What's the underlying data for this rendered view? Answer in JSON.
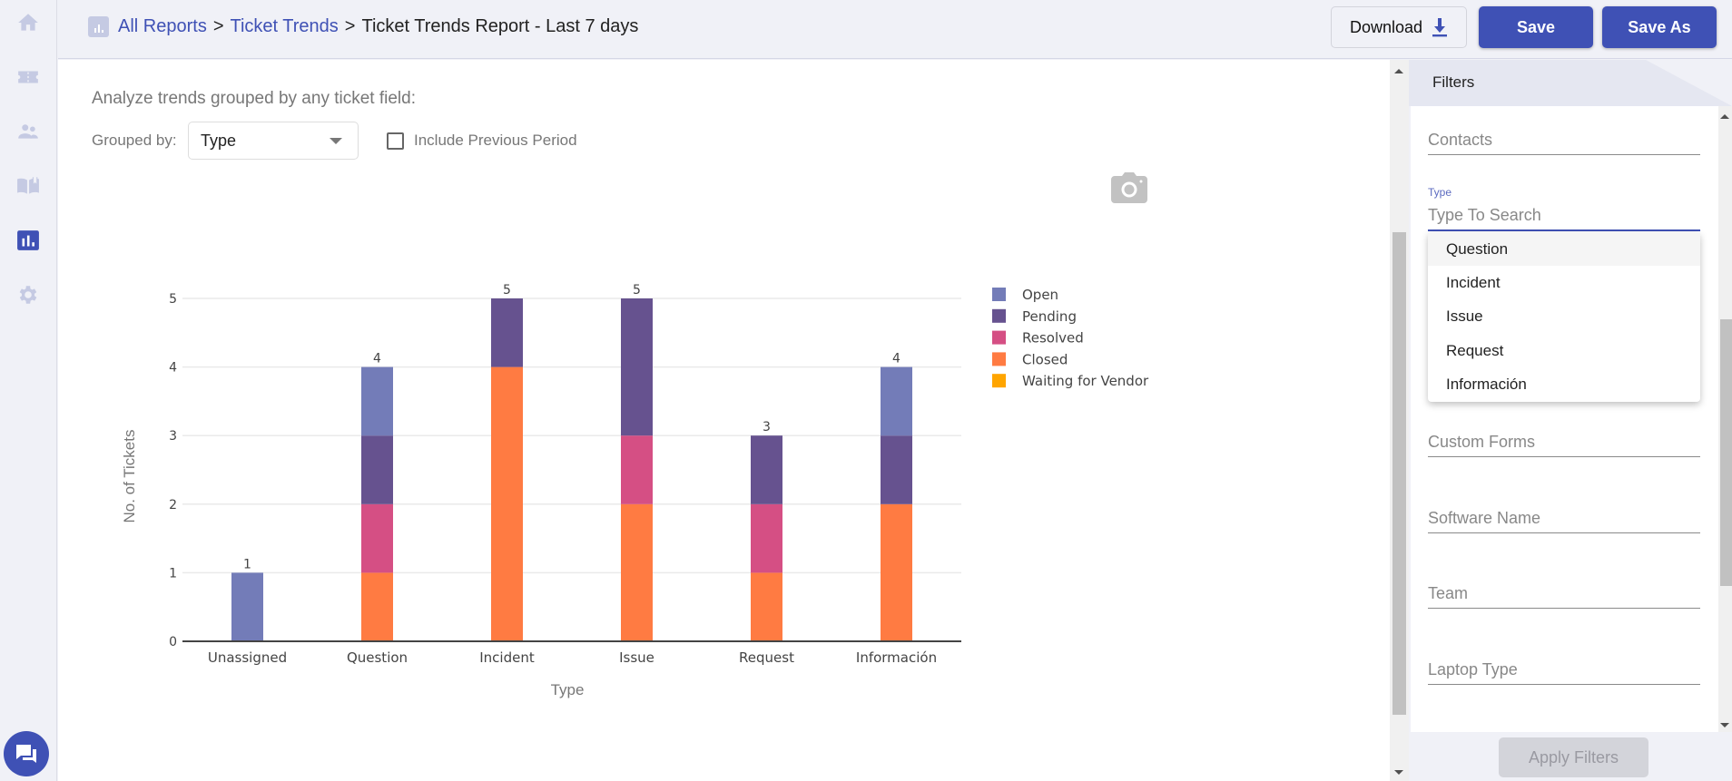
{
  "sidebar": {
    "items": [
      {
        "name": "home",
        "icon": "home-icon",
        "active": false
      },
      {
        "name": "tickets",
        "icon": "ticket-icon",
        "active": false
      },
      {
        "name": "contacts",
        "icon": "users-icon",
        "active": false
      },
      {
        "name": "knowledge-base",
        "icon": "book-icon",
        "active": false
      },
      {
        "name": "reports",
        "icon": "bar-chart-icon",
        "active": true
      },
      {
        "name": "settings",
        "icon": "gear-icon",
        "active": false
      }
    ],
    "chat_icon": "chat-icon"
  },
  "header": {
    "breadcrumb": [
      {
        "label": "All Reports",
        "link": true
      },
      {
        "label": "Ticket Trends",
        "link": true
      },
      {
        "label": "Ticket Trends Report - Last 7 days",
        "link": false
      }
    ],
    "separator": ">",
    "download_label": "Download",
    "save_label": "Save",
    "save_as_label": "Save As"
  },
  "main": {
    "intro": "Analyze trends grouped by any ticket field:",
    "grouped_by_label": "Grouped by:",
    "grouped_by_value": "Type",
    "include_previous_label": "Include Previous Period",
    "include_previous_checked": false
  },
  "colors": {
    "accent": "#3f51b5",
    "Open": "#737cb8",
    "Pending": "#66528f",
    "Resolved": "#d54f84",
    "Closed": "#ff7b42",
    "Waiting for Vendor": "#ffa500"
  },
  "chart_data": {
    "type": "bar",
    "stacked": true,
    "categories": [
      "Unassigned",
      "Question",
      "Incident",
      "Issue",
      "Request",
      "Información"
    ],
    "series": [
      {
        "name": "Closed",
        "values": [
          0,
          1,
          4,
          2,
          1,
          2
        ]
      },
      {
        "name": "Resolved",
        "values": [
          0,
          1,
          0,
          1,
          1,
          0
        ]
      },
      {
        "name": "Pending",
        "values": [
          0,
          1,
          1,
          2,
          1,
          1
        ]
      },
      {
        "name": "Open",
        "values": [
          1,
          1,
          0,
          0,
          0,
          1
        ]
      },
      {
        "name": "Waiting for Vendor",
        "values": [
          0,
          0,
          0,
          0,
          0,
          0
        ]
      }
    ],
    "totals": [
      1,
      4,
      5,
      5,
      3,
      4
    ],
    "legend": [
      "Open",
      "Pending",
      "Resolved",
      "Closed",
      "Waiting for Vendor"
    ],
    "legend_position": "right",
    "xlabel": "Type",
    "ylabel": "No. of Tickets",
    "yticks": [
      0,
      1,
      2,
      3,
      4,
      5
    ],
    "ylim": [
      0,
      5
    ],
    "grid": true
  },
  "filters": {
    "title": "Filters",
    "fields": [
      {
        "label": "Contacts"
      },
      {
        "label": "Custom Forms"
      },
      {
        "label": "Software Name"
      },
      {
        "label": "Team"
      },
      {
        "label": "Laptop Type"
      }
    ],
    "type_field": {
      "label": "Type",
      "placeholder": "Type To Search",
      "options": [
        "Question",
        "Incident",
        "Issue",
        "Request",
        "Información"
      ],
      "highlighted": "Question"
    },
    "apply_label": "Apply Filters"
  }
}
